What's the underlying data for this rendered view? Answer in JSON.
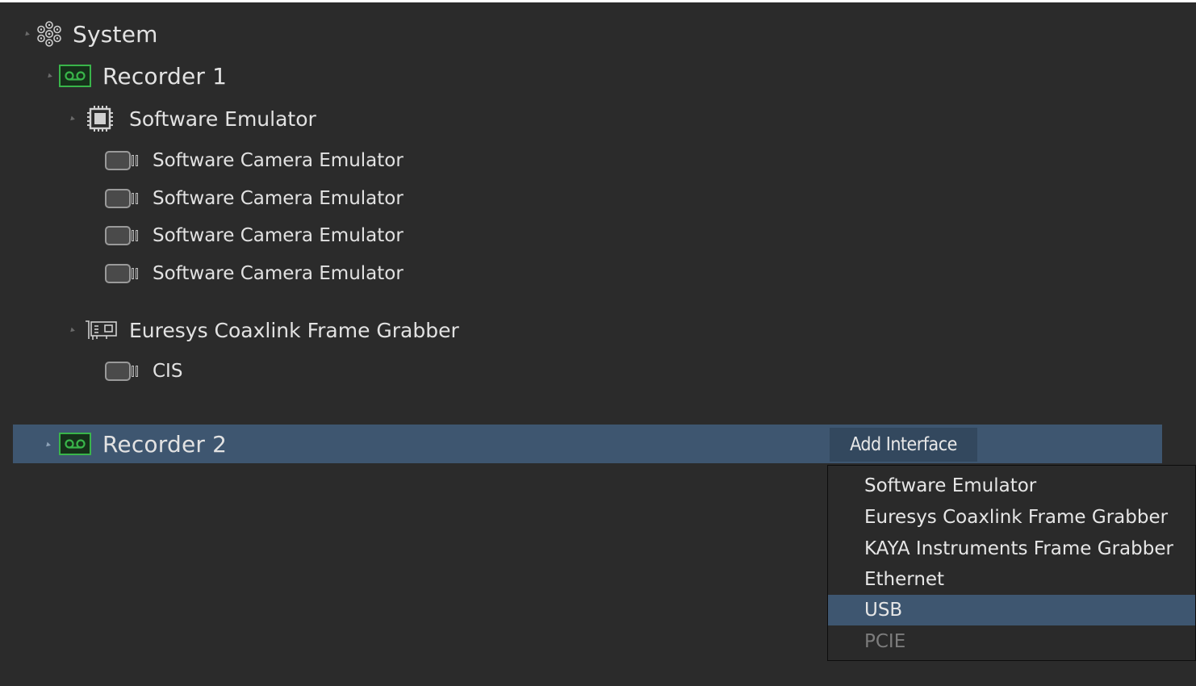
{
  "tree": {
    "system_label": "System",
    "recorder1": {
      "label": "Recorder 1",
      "software_emulator": {
        "label": "Software Emulator",
        "cameras": [
          "Software Camera Emulator",
          "Software Camera Emulator",
          "Software Camera Emulator",
          "Software Camera Emulator"
        ]
      },
      "frame_grabber": {
        "label": "Euresys Coaxlink Frame Grabber",
        "cameras": [
          "CIS"
        ]
      }
    },
    "recorder2": {
      "label": "Recorder 2",
      "selected": true
    }
  },
  "context": {
    "add_interface_label": "Add Interface",
    "menu_items": [
      {
        "label": "Software Emulator",
        "state": "normal"
      },
      {
        "label": "Euresys Coaxlink Frame Grabber",
        "state": "normal"
      },
      {
        "label": "KAYA Instruments Frame Grabber",
        "state": "normal"
      },
      {
        "label": "Ethernet",
        "state": "normal"
      },
      {
        "label": "USB",
        "state": "highlighted"
      },
      {
        "label": "PCIE",
        "state": "disabled"
      }
    ]
  },
  "colors": {
    "background": "#2b2b2b",
    "selection": "#3e5670",
    "recorder_icon": "#39b54a",
    "disabled_text": "#7c7c7c"
  },
  "icons": {
    "system": "system-nodes-icon",
    "recorder": "recorder-tape-icon",
    "emulator": "chip-icon",
    "grabber": "pci-card-icon",
    "camera": "camera-icon"
  }
}
